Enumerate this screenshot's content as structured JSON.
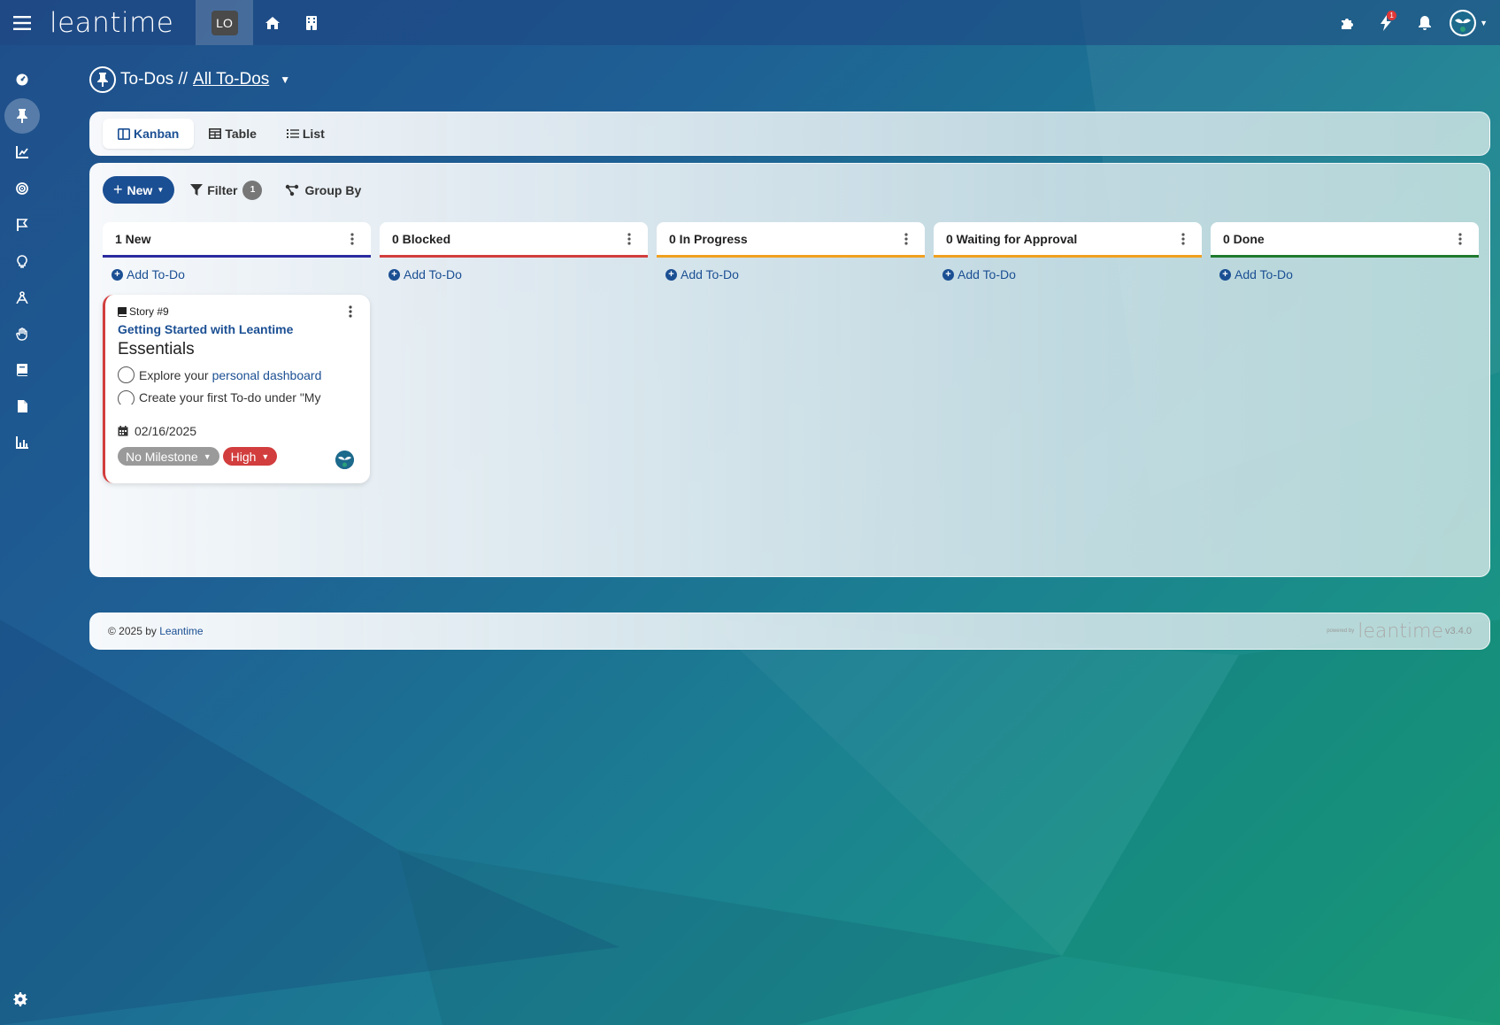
{
  "app": {
    "logo": "leantime",
    "project_initials": "LO"
  },
  "topbar": {
    "notification_count": "1"
  },
  "header": {
    "section": "To-Dos //",
    "view_name": "All To-Dos"
  },
  "tabs": [
    {
      "label": "Kanban",
      "active": true
    },
    {
      "label": "Table",
      "active": false
    },
    {
      "label": "List",
      "active": false
    }
  ],
  "toolbar": {
    "new_label": "New",
    "filter_label": "Filter",
    "filter_count": "1",
    "groupby_label": "Group By"
  },
  "columns": [
    {
      "title": "1 New",
      "color": "#2b2ba0",
      "add_label": "Add To-Do"
    },
    {
      "title": "0 Blocked",
      "color": "#d23d3d",
      "add_label": "Add To-Do"
    },
    {
      "title": "0 In Progress",
      "color": "#f0a020",
      "add_label": "Add To-Do"
    },
    {
      "title": "0 Waiting for Approval",
      "color": "#f0a020",
      "add_label": "Add To-Do"
    },
    {
      "title": "0 Done",
      "color": "#1f7a2e",
      "add_label": "Add To-Do"
    }
  ],
  "card": {
    "type": "Story #9",
    "title": "Getting Started with Leantime",
    "heading": "Essentials",
    "checklist": [
      {
        "text": "Explore your",
        "link": "personal dashboard"
      },
      {
        "text": "Create your first To-do under \"My"
      }
    ],
    "date": "02/16/2025",
    "milestone": "No Milestone",
    "priority": "High",
    "priority_color": "#d23d3d",
    "milestone_color": "#9a9a9a"
  },
  "footer": {
    "copyright": "© 2025 by",
    "link": "Leantime",
    "powered": "powered by",
    "brand": "leantime",
    "version": "v3.4.0"
  }
}
